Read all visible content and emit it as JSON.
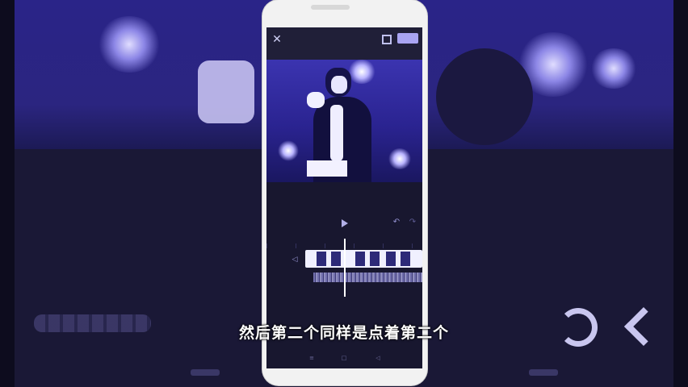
{
  "subtitle": "然后第二个同样是点着第二个",
  "editor": {
    "close_icon": "✕",
    "undo_icon": "↶",
    "redo_icon": "↷",
    "mute_icon": "◁",
    "nav_buttons": [
      "≡",
      "□",
      "◁"
    ]
  },
  "colors": {
    "background": "#14122b",
    "accent": "#a9a4f2",
    "phone_frame": "#f2f2f2"
  }
}
